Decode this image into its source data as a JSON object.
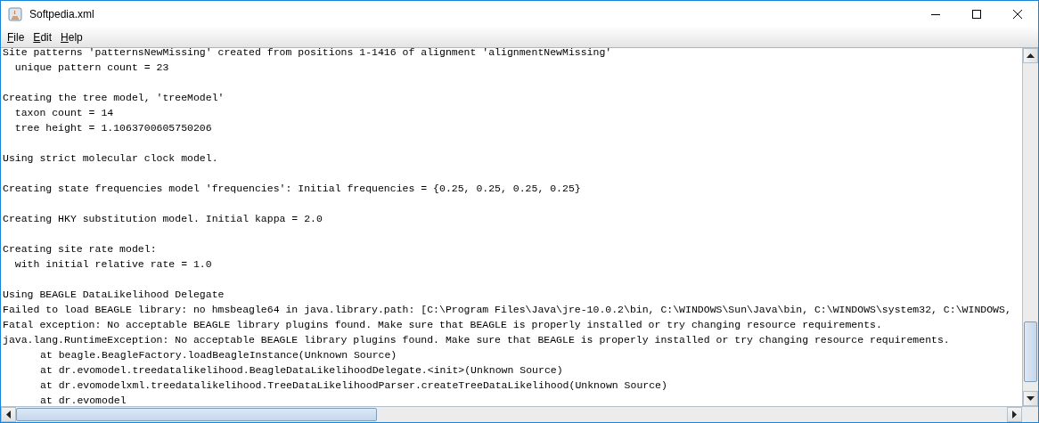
{
  "window": {
    "title": "Softpedia.xml",
    "controls": [
      {
        "kind": "minimize"
      },
      {
        "kind": "maximize"
      },
      {
        "kind": "close"
      }
    ]
  },
  "menu": [
    {
      "label": "File"
    },
    {
      "label": "Edit"
    },
    {
      "label": "Help"
    }
  ],
  "log": [
    {
      "kind": "text",
      "text": "Site patterns 'patternsNewMissing' created from positions 1-1416 of alignment 'alignmentNewMissing'"
    },
    {
      "kind": "text",
      "text": "  unique pattern count = 23"
    },
    {
      "kind": "blank"
    },
    {
      "kind": "text",
      "text": "Creating the tree model, 'treeModel'"
    },
    {
      "kind": "text",
      "text": "  taxon count = 14"
    },
    {
      "kind": "text",
      "text": "  tree height = 1.1063700605750206"
    },
    {
      "kind": "blank"
    },
    {
      "kind": "text",
      "text": "Using strict molecular clock model."
    },
    {
      "kind": "blank"
    },
    {
      "kind": "text",
      "text": "Creating state frequencies model 'frequencies': Initial frequencies = {0.25, 0.25, 0.25, 0.25}"
    },
    {
      "kind": "blank"
    },
    {
      "kind": "text",
      "text": "Creating HKY substitution model. Initial kappa = 2.0"
    },
    {
      "kind": "blank"
    },
    {
      "kind": "text",
      "text": "Creating site rate model:"
    },
    {
      "kind": "text",
      "text": "  with initial relative rate = 1.0"
    },
    {
      "kind": "blank"
    },
    {
      "kind": "text",
      "text": "Using BEAGLE DataLikelihood Delegate"
    },
    {
      "kind": "text",
      "text": "Failed to load BEAGLE library: no hmsbeagle64 in java.library.path: [C:\\Program Files\\Java\\jre-10.0.2\\bin, C:\\WINDOWS\\Sun\\Java\\bin, C:\\WINDOWS\\system32, C:\\WINDOWS,"
    },
    {
      "kind": "text",
      "text": "Fatal exception: No acceptable BEAGLE library plugins found. Make sure that BEAGLE is properly installed or try changing resource requirements."
    },
    {
      "kind": "text",
      "text": "java.lang.RuntimeException: No acceptable BEAGLE library plugins found. Make sure that BEAGLE is properly installed or try changing resource requirements."
    },
    {
      "kind": "stack",
      "text": "at beagle.BeagleFactory.loadBeagleInstance(Unknown Source)"
    },
    {
      "kind": "stack",
      "text": "at dr.evomodel.treedatalikelihood.BeagleDataLikelihoodDelegate.<init>(Unknown Source)"
    },
    {
      "kind": "stack",
      "text": "at dr.evomodelxml.treedatalikelihood.TreeDataLikelihoodParser.createTreeDataLikelihood(Unknown Source)"
    },
    {
      "kind": "stack",
      "text": "at dr.evomodel"
    }
  ]
}
